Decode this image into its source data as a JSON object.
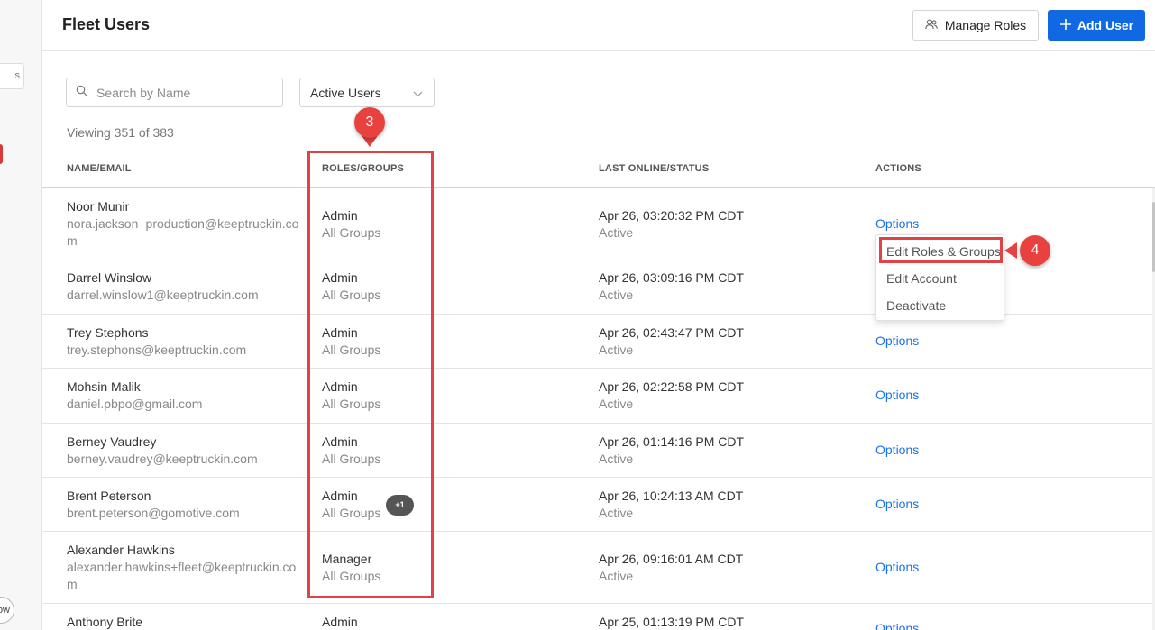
{
  "sidebar": {
    "pill_text": "s",
    "round_text": "ow"
  },
  "header": {
    "title": "Fleet Users",
    "manage_roles_label": "Manage Roles",
    "add_user_label": "Add User"
  },
  "filters": {
    "search_placeholder": "Search by Name",
    "search_value": "",
    "status_select": "Active Users",
    "viewing_text": "Viewing 351 of 383"
  },
  "table": {
    "columns": [
      "NAME/EMAIL",
      "ROLES/GROUPS",
      "LAST ONLINE/STATUS",
      "ACTIONS"
    ],
    "rows": [
      {
        "name": "Noor Munir",
        "email_line1": "nora.jackson+production@keeptruckin.co",
        "email_line2": "m",
        "role": "Admin",
        "group": "All Groups",
        "last_online": "Apr 26, 03:20:32 PM CDT",
        "status": "Active",
        "action": "Options"
      },
      {
        "name": "Darrel Winslow",
        "email_line1": "darrel.winslow1@keeptruckin.com",
        "email_line2": "",
        "role": "Admin",
        "group": "All Groups",
        "last_online": "Apr 26, 03:09:16 PM CDT",
        "status": "Active",
        "action": ""
      },
      {
        "name": "Trey Stephons",
        "email_line1": "trey.stephons@keeptruckin.com",
        "email_line2": "",
        "role": "Admin",
        "group": "All Groups",
        "last_online": "Apr 26, 02:43:47 PM CDT",
        "status": "Active",
        "action": "Options"
      },
      {
        "name": "Mohsin Malik",
        "email_line1": "daniel.pbpo@gmail.com",
        "email_line2": "",
        "role": "Admin",
        "group": "All Groups",
        "last_online": "Apr 26, 02:22:58 PM CDT",
        "status": "Active",
        "action": "Options"
      },
      {
        "name": "Berney Vaudrey",
        "email_line1": "berney.vaudrey@keeptruckin.com",
        "email_line2": "",
        "role": "Admin",
        "group": "All Groups",
        "last_online": "Apr 26, 01:14:16 PM CDT",
        "status": "Active",
        "action": "Options"
      },
      {
        "name": "Brent Peterson",
        "email_line1": "brent.peterson@gomotive.com",
        "email_line2": "",
        "role": "Admin",
        "group": "All Groups",
        "badge": "+1",
        "last_online": "Apr 26, 10:24:13 AM CDT",
        "status": "Active",
        "action": "Options"
      },
      {
        "name": "Alexander Hawkins",
        "email_line1": "alexander.hawkins+fleet@keeptruckin.co",
        "email_line2": "m",
        "role": "Manager",
        "group": "All Groups",
        "last_online": "Apr 26, 09:16:01 AM CDT",
        "status": "Active",
        "action": "Options"
      },
      {
        "name": "Anthony Brite",
        "email_line1": "",
        "email_line2": "",
        "role": "Admin",
        "group": "",
        "last_online": "Apr 25, 01:13:19 PM CDT",
        "status": "",
        "action": "Options"
      }
    ]
  },
  "options_menu": {
    "items": [
      "Edit Roles & Groups",
      "Edit Account",
      "Deactivate"
    ]
  },
  "annotations": {
    "step_roles": "3",
    "step_edit": "4"
  },
  "colors": {
    "primary_blue": "#1068e3",
    "link_blue": "#1a73e8",
    "annotation_red": "#e04345"
  },
  "icons": {
    "manage_roles": "users-icon",
    "add_user": "plus-icon",
    "search": "search-icon",
    "select": "chevron-down-icon"
  }
}
